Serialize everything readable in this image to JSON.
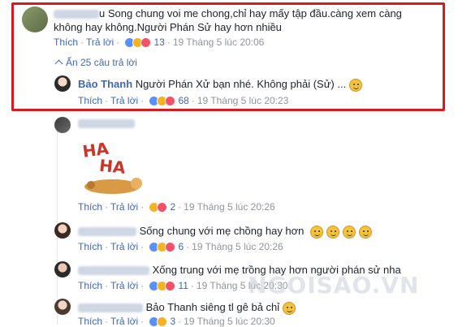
{
  "comment1": {
    "text_line1": "u Song chung voi me chong,chỉ hay mấy tập đầu.càng xem càng",
    "text_line2": "không hay không.Người Phán Sử hay hơn nhiều",
    "like": "Thích",
    "reply": "Trả lời",
    "reaction_count": "13",
    "time": "19 Tháng 5 lúc 20:06"
  },
  "hide_replies": "Ẩn 25 câu trả lời",
  "reply1": {
    "name": "Bảo Thanh",
    "text": "Người Phán Xử bạn nhé. Không phải (Sử) ...",
    "like": "Thích",
    "reply": "Trả lời",
    "reaction_count": "68",
    "time": "19 Tháng 5 lúc 20:23"
  },
  "reply2": {
    "sticker_text": "HAHA",
    "like": "Thích",
    "reply": "Trả lời",
    "reaction_count": "2",
    "time": "19 Tháng 5 lúc 20:26"
  },
  "reply3": {
    "text": "Sống chung với mẹ chồng hay hơn",
    "like": "Thích",
    "reply": "Trả lời",
    "reaction_count": "6",
    "time": "19 Tháng 5 lúc 20:26"
  },
  "reply4": {
    "text": "Xống trung với mẹ trồng hay hơn người phán sử nha",
    "like": "Thích",
    "reply": "Trả lời",
    "reaction_count": "11",
    "time": "19 Tháng 5 lúc 20:30"
  },
  "reply5": {
    "text": "Bảo Thanh siêng tl gê bả chỉ",
    "like": "Thích",
    "reply": "Trả lời",
    "reaction_count": "3",
    "time": "19 Tháng 5 lúc 20:30"
  },
  "watermark": "NGOISAO.VN",
  "colors": {
    "link": "#4267b2",
    "meta": "#90949c",
    "highlight": "#d71920"
  }
}
